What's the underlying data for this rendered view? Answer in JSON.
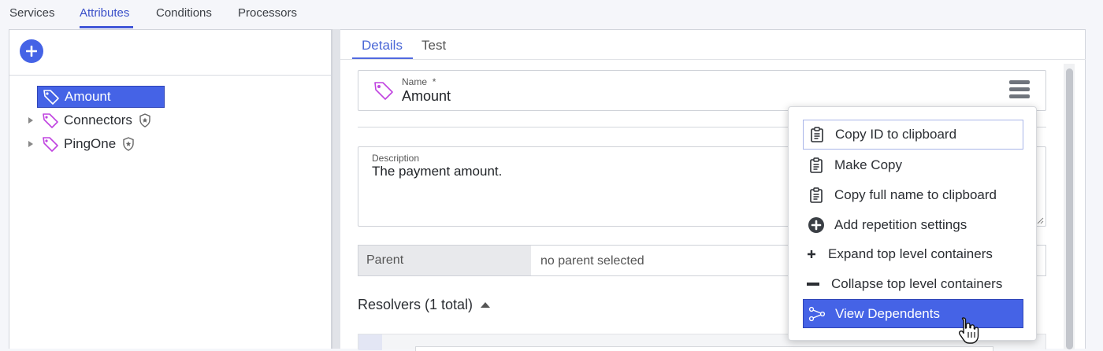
{
  "topnav": {
    "tabs": [
      {
        "label": "Services"
      },
      {
        "label": "Attributes"
      },
      {
        "label": "Conditions"
      },
      {
        "label": "Processors"
      }
    ],
    "active": "Attributes"
  },
  "tree": {
    "add_icon": "plus-circle-icon",
    "items": [
      {
        "label": "Amount",
        "selected": true
      },
      {
        "label": "Connectors",
        "selected": false
      },
      {
        "label": "PingOne",
        "selected": false
      }
    ]
  },
  "detail": {
    "tabs": [
      {
        "label": "Details"
      },
      {
        "label": "Test"
      }
    ],
    "name_label": "Name",
    "name_required": "*",
    "name_value": "Amount",
    "description_label": "Description",
    "description_value": "The payment amount.",
    "parent_label": "Parent",
    "parent_value": "no parent selected",
    "resolvers_label": "Resolvers (1 total)"
  },
  "menu": {
    "items": [
      {
        "label": "Copy ID to clipboard",
        "icon": "clipboard-icon"
      },
      {
        "label": "Make Copy",
        "icon": "clipboard-icon"
      },
      {
        "label": "Copy full name to clipboard",
        "icon": "clipboard-icon"
      },
      {
        "label": "Add repetition settings",
        "icon": "plus-circle-icon"
      },
      {
        "label": "Expand top level containers",
        "icon": "plus-icon"
      },
      {
        "label": "Collapse top level containers",
        "icon": "minus-icon"
      },
      {
        "label": "View Dependents",
        "icon": "share-icon"
      }
    ]
  },
  "colors": {
    "accent": "#4563e6",
    "tag_icon": "#c044e0"
  }
}
